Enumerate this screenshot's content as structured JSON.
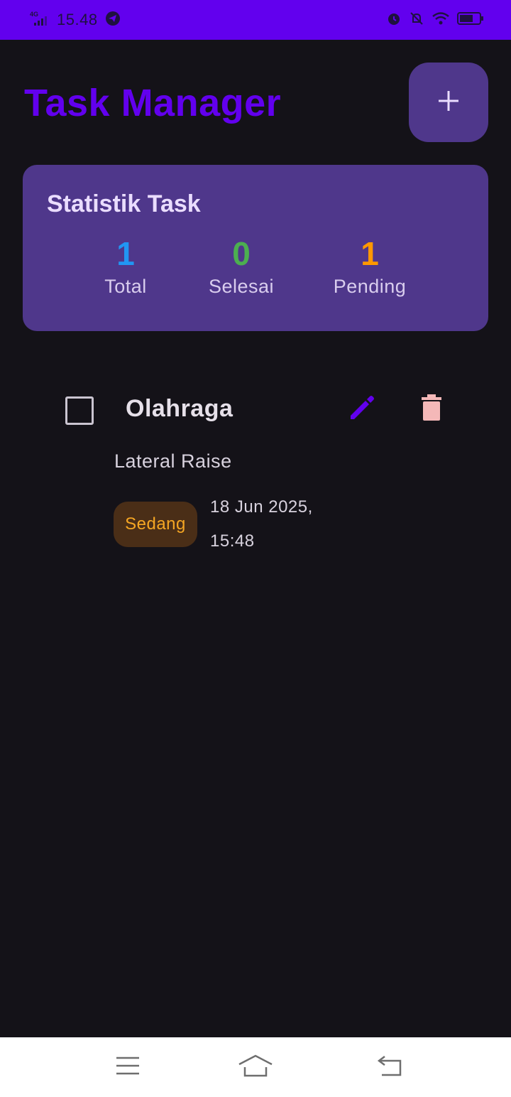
{
  "status_bar": {
    "network": "4G",
    "time": "15.48",
    "icons": [
      "signal-icon",
      "telegram-icon",
      "alarm-icon",
      "bell-off-icon",
      "wifi-icon",
      "battery-icon"
    ]
  },
  "header": {
    "title": "Task Manager",
    "add_icon": "plus-icon"
  },
  "stats": {
    "title": "Statistik Task",
    "items": [
      {
        "value": "1",
        "label": "Total",
        "color": "#2196f3"
      },
      {
        "value": "0",
        "label": "Selesai",
        "color": "#4caf50"
      },
      {
        "value": "1",
        "label": "Pending",
        "color": "#ff9800"
      }
    ]
  },
  "tasks": [
    {
      "title": "Olahraga",
      "description": "Lateral Raise",
      "priority": "Sedang",
      "date_line1": "18 Jun 2025,",
      "date_line2": "15:48",
      "completed": false
    }
  ],
  "colors": {
    "accent": "#6200ee",
    "card": "#4f378b",
    "background": "#141218",
    "delete": "#f4b8b8",
    "priority_medium": "#f5a623"
  },
  "nav": {
    "icons": [
      "menu-icon",
      "home-icon",
      "back-icon"
    ]
  }
}
